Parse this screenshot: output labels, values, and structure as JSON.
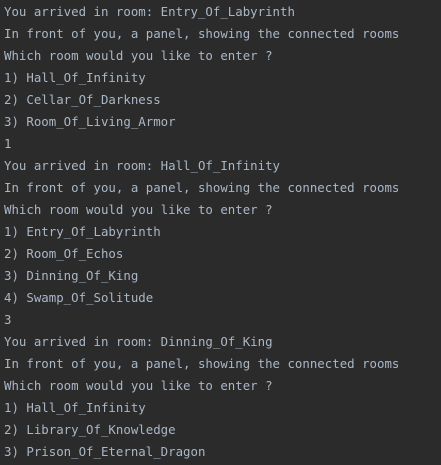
{
  "console": {
    "lines": [
      {
        "text": "You arrived in room: Entry_Of_Labyrinth",
        "kind": "output"
      },
      {
        "text": "In front of you, a panel, showing the connected rooms",
        "kind": "output"
      },
      {
        "text": "Which room would you like to enter ?",
        "kind": "output"
      },
      {
        "text": "1) Hall_Of_Infinity",
        "kind": "output"
      },
      {
        "text": "2) Cellar_Of_Darkness",
        "kind": "output"
      },
      {
        "text": "3) Room_Of_Living_Armor",
        "kind": "output"
      },
      {
        "text": "1",
        "kind": "input"
      },
      {
        "text": "You arrived in room: Hall_Of_Infinity",
        "kind": "output"
      },
      {
        "text": "In front of you, a panel, showing the connected rooms",
        "kind": "output"
      },
      {
        "text": "Which room would you like to enter ?",
        "kind": "output"
      },
      {
        "text": "1) Entry_Of_Labyrinth",
        "kind": "output"
      },
      {
        "text": "2) Room_Of_Echos",
        "kind": "output"
      },
      {
        "text": "3) Dinning_Of_King",
        "kind": "output"
      },
      {
        "text": "4) Swamp_Of_Solitude",
        "kind": "output"
      },
      {
        "text": "3",
        "kind": "input"
      },
      {
        "text": "You arrived in room: Dinning_Of_King",
        "kind": "output"
      },
      {
        "text": "In front of you, a panel, showing the connected rooms",
        "kind": "output"
      },
      {
        "text": "Which room would you like to enter ?",
        "kind": "output"
      },
      {
        "text": "1) Hall_Of_Infinity",
        "kind": "output"
      },
      {
        "text": "2) Library_Of_Knowledge",
        "kind": "output"
      },
      {
        "text": "3) Prison_Of_Eternal_Dragon",
        "kind": "output"
      }
    ]
  },
  "colors": {
    "background": "#2b2b2b",
    "text": "#a9b7c6"
  }
}
